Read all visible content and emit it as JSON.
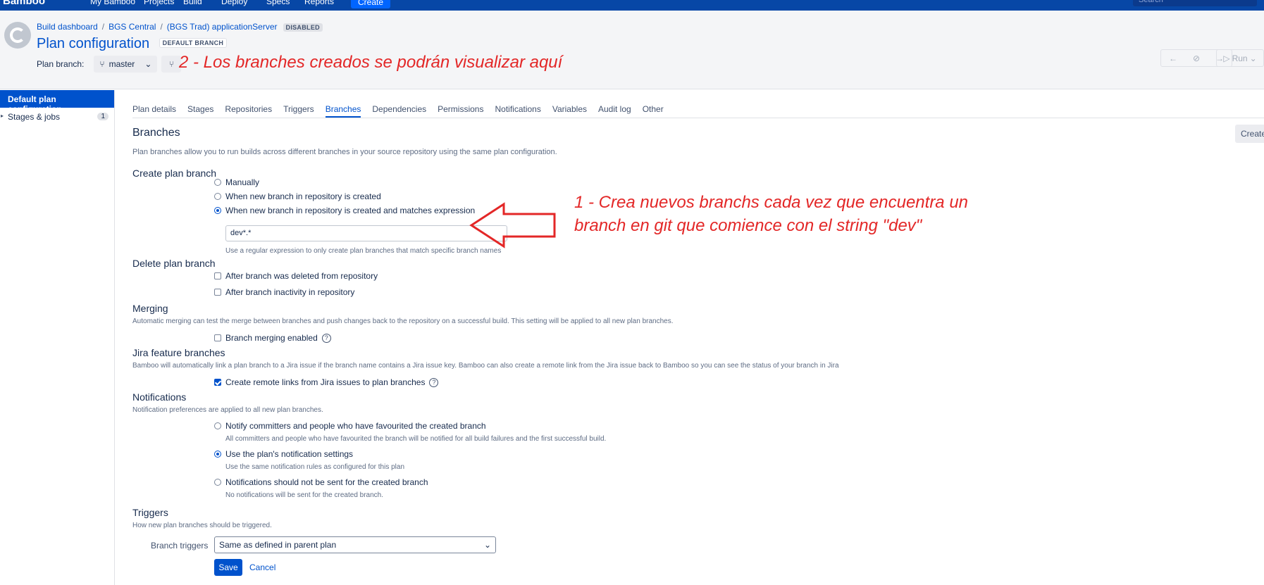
{
  "topnav": {
    "logo": "Bamboo",
    "items": [
      "My Bamboo",
      "Projects",
      "Build",
      "Deploy",
      "Specs",
      "Reports"
    ],
    "create": "Create",
    "search_placeholder": "Search"
  },
  "header": {
    "breadcrumb": [
      "Build dashboard",
      "BGS Central",
      "(BGS Trad) applicationServer"
    ],
    "status_badge": "DISABLED",
    "title": "Plan configuration",
    "title_badge": "DEFAULT BRANCH",
    "branch_label": "Plan branch:",
    "branch_value": "master",
    "run_label": "Run",
    "annotation": "2 - Los branches creados se podrán visualizar aquí"
  },
  "sidebar": {
    "active_item": "Default plan configuration",
    "items": [
      {
        "label": "Stages & jobs",
        "count": "1"
      }
    ]
  },
  "tabs": [
    "Plan details",
    "Stages",
    "Repositories",
    "Triggers",
    "Branches",
    "Dependencies",
    "Permissions",
    "Notifications",
    "Variables",
    "Audit log",
    "Other"
  ],
  "active_tab": "Branches",
  "branches": {
    "heading": "Branches",
    "create_button": "Create",
    "description": "Plan branches allow you to run builds across different branches in your source repository using the same plan configuration.",
    "create_plan_branch": {
      "title": "Create plan branch",
      "options": [
        "Manually",
        "When new branch in repository is created",
        "When new branch in repository is created and matches expression"
      ],
      "selected": 2,
      "expression_value": "dev*.*",
      "expression_help": "Use a regular expression to only create plan branches that match specific branch names"
    },
    "delete_plan_branch": {
      "title": "Delete plan branch",
      "options": [
        "After branch was deleted from repository",
        "After branch inactivity in repository"
      ]
    },
    "merging": {
      "title": "Merging",
      "description": "Automatic merging can test the merge between branches and push changes back to the repository on a successful build. This setting will be applied to all new plan branches.",
      "option": "Branch merging enabled"
    },
    "jira": {
      "title": "Jira feature branches",
      "description": "Bamboo will automatically link a plan branch to a Jira issue if the branch name contains a Jira issue key. Bamboo can also create a remote link from the Jira issue back to Bamboo so you can see the status of your branch in Jira",
      "option": "Create remote links from Jira issues to plan branches"
    },
    "notifications": {
      "title": "Notifications",
      "description": "Notification preferences are applied to all new plan branches.",
      "options": [
        {
          "label": "Notify committers and people who have favourited the created branch",
          "help": "All committers and people who have favourited the branch will be notified for all build failures and the first successful build."
        },
        {
          "label": "Use the plan's notification settings",
          "help": "Use the same notification rules as configured for this plan"
        },
        {
          "label": "Notifications should not be sent for the created branch",
          "help": "No notifications will be sent for the created branch."
        }
      ],
      "selected": 1
    },
    "triggers": {
      "title": "Triggers",
      "description": "How new plan branches should be triggered.",
      "label": "Branch triggers",
      "value": "Same as defined in parent plan"
    },
    "save": "Save",
    "cancel": "Cancel",
    "annotation": "1 - Crea nuevos branchs cada vez que encuentra un branch en git que comience con el string \"dev\""
  },
  "colors": {
    "accent": "#0052cc",
    "nav": "#0747a6",
    "annotation": "#e32727"
  }
}
